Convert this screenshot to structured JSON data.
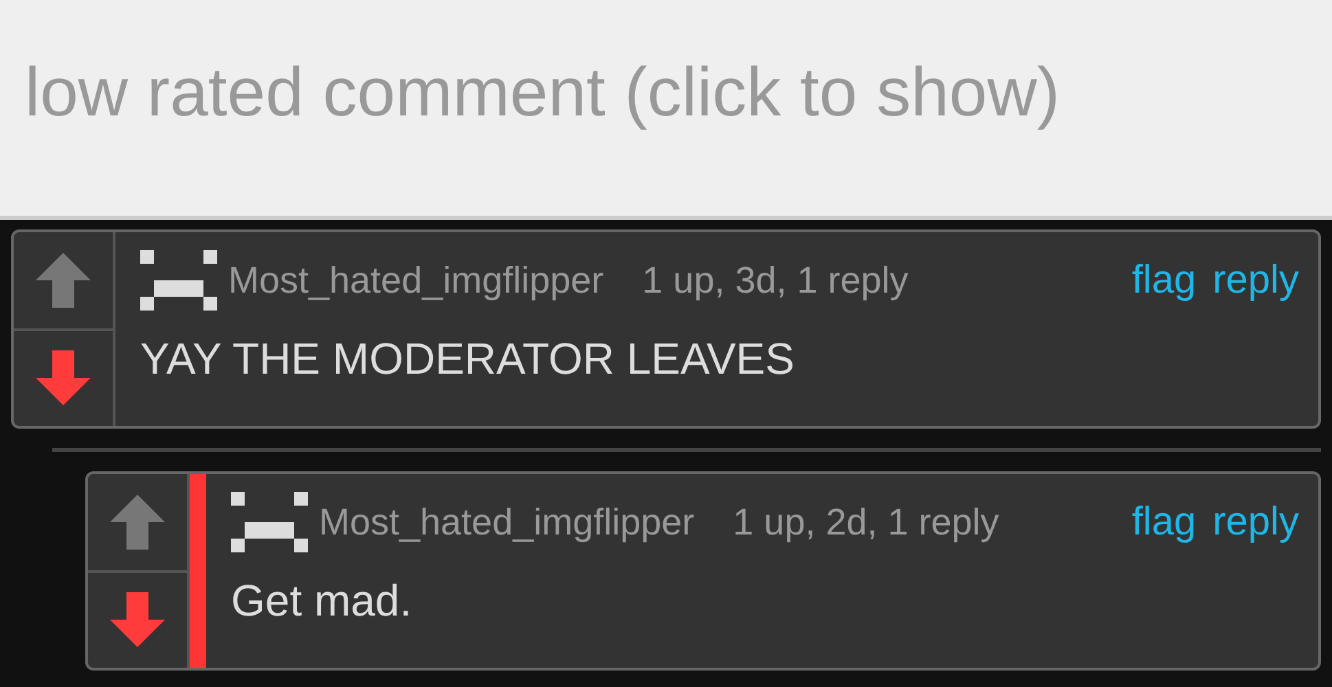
{
  "collapsed_notice": {
    "text": "low rated comment (click to show)"
  },
  "comments": [
    {
      "username": "Most_hated_imgflipper",
      "meta": "1 up, 3d, 1 reply",
      "actions": [
        "flag",
        "reply"
      ],
      "text": "YAY THE MODERATOR LEAVES",
      "upvoted": false,
      "downvoted": true,
      "highlighted": false,
      "children": [
        {
          "username": "Most_hated_imgflipper",
          "meta": "1 up, 2d, 1 reply",
          "actions": [
            "flag",
            "reply"
          ],
          "text": "Get mad.",
          "upvoted": false,
          "downvoted": true,
          "highlighted": true
        }
      ]
    }
  ]
}
